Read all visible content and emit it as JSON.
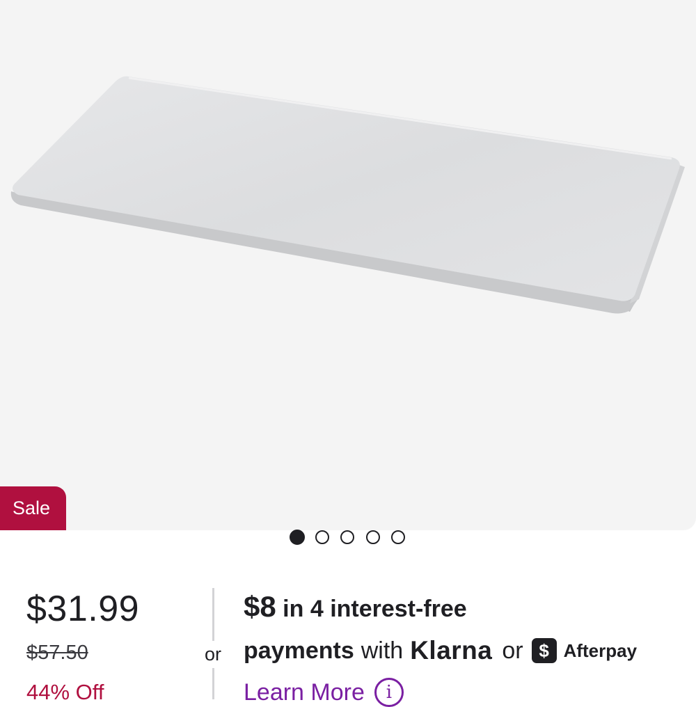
{
  "product": {
    "image_alt": "White vinyl-covered rectangular mat",
    "sale_badge": "Sale",
    "carousel": {
      "count": 5,
      "active_index": 0
    }
  },
  "pricing": {
    "current": "$31.99",
    "original": "$57.50",
    "discount": "44% Off"
  },
  "separator_text": "or",
  "installments": {
    "amount": "$8",
    "line1_rest": "in 4 interest-free",
    "line2_bold": "payments",
    "line2_with": "with",
    "provider_klarna": "Klarna",
    "line2_or": "or",
    "afterpay_mark": "$",
    "provider_afterpay": "Afterpay",
    "learn_more": "Learn More",
    "info_glyph": "i"
  },
  "colors": {
    "brand_sale": "#b0103f",
    "link_purple": "#7a1fa2",
    "image_bg": "#f4f4f4"
  }
}
